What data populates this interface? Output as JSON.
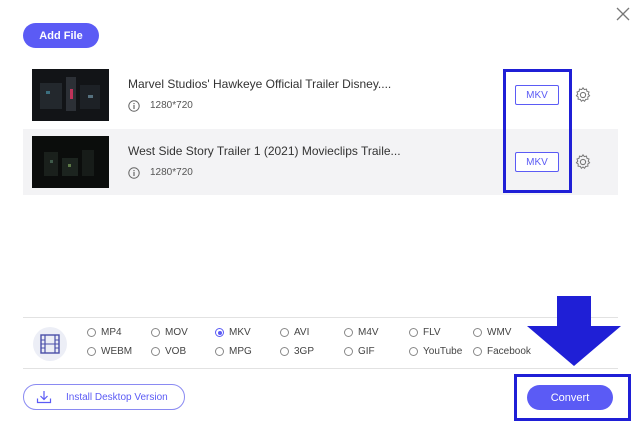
{
  "toolbar": {
    "add_file_label": "Add File"
  },
  "files": [
    {
      "title": "Marvel Studios' Hawkeye Official Trailer Disney....",
      "resolution": "1280*720",
      "format": "MKV"
    },
    {
      "title": "West Side Story Trailer 1 (2021) Movieclips Traile...",
      "resolution": "1280*720",
      "format": "MKV"
    }
  ],
  "formats": {
    "selected": "MKV",
    "row1": [
      "MP4",
      "MOV",
      "MKV",
      "AVI",
      "M4V",
      "FLV",
      "WMV"
    ],
    "row2": [
      "WEBM",
      "VOB",
      "MPG",
      "3GP",
      "GIF",
      "YouTube",
      "Facebook"
    ]
  },
  "footer": {
    "install_label": "Install Desktop Version",
    "convert_label": "Convert"
  },
  "colors": {
    "accent": "#5b5bf5",
    "annotation": "#1f1fd6"
  }
}
